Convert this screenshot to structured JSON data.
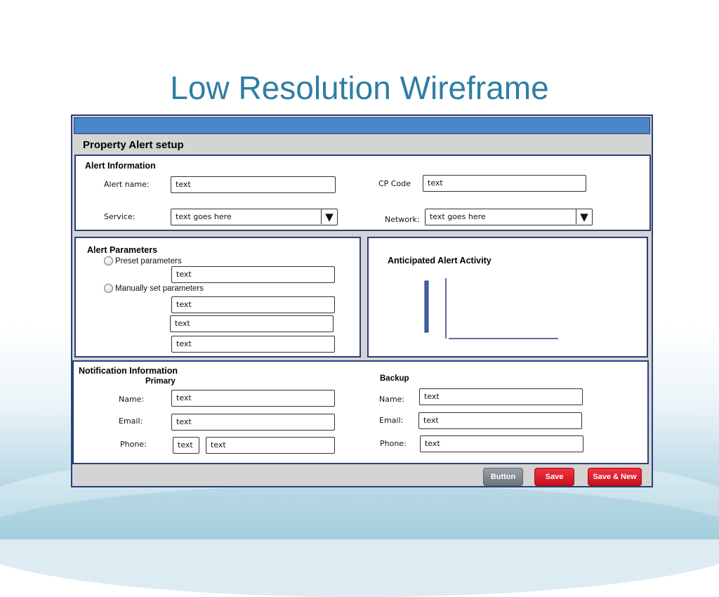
{
  "slide": {
    "title": "Low Resolution Wireframe"
  },
  "form": {
    "title": "Property Alert setup",
    "alert_info": {
      "heading": "Alert Information",
      "alert_name_label": "Alert name:",
      "alert_name_value": "text",
      "cp_code_label": "CP Code",
      "cp_code_value": "text",
      "service_label": "Service:",
      "service_value": "text goes here",
      "network_label": "Network:",
      "network_value": "text goes here"
    },
    "alert_params": {
      "heading": "Alert Parameters",
      "preset_label": "Preset parameters",
      "preset_value": "text",
      "manual_label": "Manually set parameters",
      "manual_values": [
        "text",
        "text",
        "text"
      ]
    },
    "activity": {
      "heading": "Anticipated Alert Activity"
    },
    "notification": {
      "heading": "Notification Information",
      "primary": {
        "heading": "Primary",
        "name_label": "Name:",
        "name_value": "text",
        "email_label": "Email:",
        "email_value": "text",
        "phone_label": "Phone:",
        "phone_value_1": "text",
        "phone_value_2": "text"
      },
      "backup": {
        "heading": "Backup",
        "name_label": "Name:",
        "name_value": "text",
        "email_label": "Email:",
        "email_value": "text",
        "phone_label": "Phone:",
        "phone_value": "text"
      }
    },
    "buttons": {
      "button_label": "Button",
      "save_label": "Save",
      "save_new_label": "Save & New"
    }
  },
  "icons": {
    "dropdown": "dropdown-triangle-icon",
    "radio": "radio-button-icon"
  },
  "colors": {
    "title": "#2e7ea3",
    "topbar": "#4a86c8",
    "border": "#2a3f7a",
    "save": "#d81e28",
    "button": "#7d858e"
  }
}
